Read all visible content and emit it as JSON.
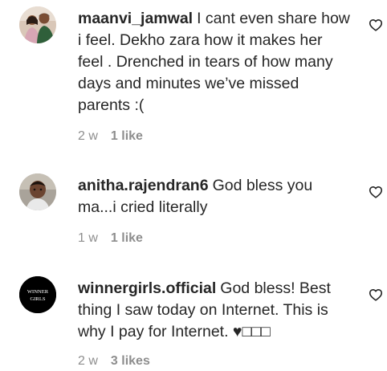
{
  "comments": [
    {
      "username": "maanvi_jamwal",
      "text": "I cant even share how i feel. Dekho zara how it makes her feel . Drenched in tears of how many days and minutes we’ve missed parents :(",
      "age": "2 w",
      "likes": "1 like",
      "avatar_icon": "couple-photo-avatar",
      "like_icon": "heart-outline-icon"
    },
    {
      "username": "anitha.rajendran6",
      "text": "God bless you ma...i cried literally",
      "age": "1 w",
      "likes": "1 like",
      "avatar_icon": "child-photo-avatar",
      "like_icon": "heart-outline-icon"
    },
    {
      "username": "winnergirls.official",
      "text": "God bless! Best thing I saw today on Internet. This is why I pay for Internet. ♥□□□",
      "age": "2 w",
      "likes": "3 likes",
      "avatar_icon": "winner-girls-logo-avatar",
      "logo_text": [
        "WINNER",
        "GIRLS"
      ],
      "like_icon": "heart-outline-icon"
    }
  ],
  "colors": {
    "text": "#262626",
    "meta": "#8e8e8e",
    "logo_bg": "#000000"
  }
}
